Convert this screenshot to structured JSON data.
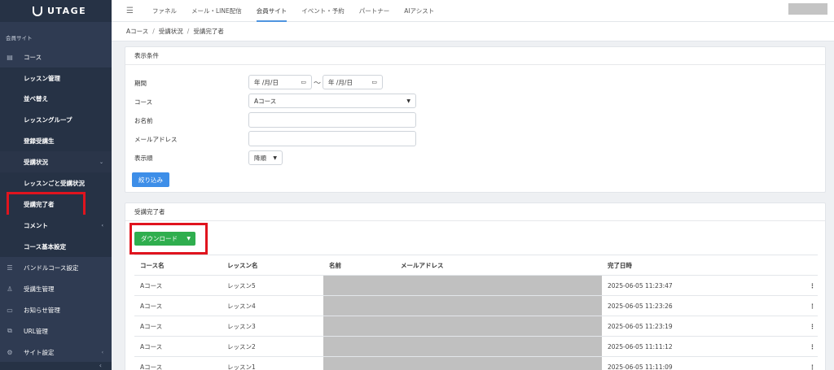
{
  "app": {
    "logo_text": "UTAGE"
  },
  "sidebar": {
    "section_label": "会員サイト",
    "items": [
      {
        "label": "コース",
        "icon": "book-icon"
      },
      {
        "label": "レッスン管理"
      },
      {
        "label": "並べ替え"
      },
      {
        "label": "レッスングループ"
      },
      {
        "label": "登録受講生"
      },
      {
        "label": "受講状況"
      },
      {
        "label": "レッスンごと受講状況"
      },
      {
        "label": "受講完了者"
      },
      {
        "label": "コメント"
      },
      {
        "label": "コース基本設定"
      },
      {
        "label": "バンドルコース設定",
        "icon": "list-icon"
      },
      {
        "label": "受講生管理",
        "icon": "user-icon"
      },
      {
        "label": "お知らせ管理",
        "icon": "news-icon"
      },
      {
        "label": "URL管理",
        "icon": "link-icon"
      },
      {
        "label": "サイト設定",
        "icon": "gear-icon"
      }
    ]
  },
  "topnav": {
    "items": [
      "ファネル",
      "メール・LINE配信",
      "会員サイト",
      "イベント・予約",
      "パートナー",
      "AIアシスト"
    ],
    "active": "会員サイト"
  },
  "breadcrumb": [
    "Aコース",
    "受講状況",
    "受講完了者"
  ],
  "filter": {
    "title": "表示条件",
    "period_label": "期間",
    "date_placeholder": "年 /月/日",
    "tilde": "～",
    "course_label": "コース",
    "course_value": "Aコース",
    "name_label": "お名前",
    "name_value": "",
    "email_label": "メールアドレス",
    "email_value": "",
    "order_label": "表示順",
    "order_value": "降順",
    "submit_label": "絞り込み"
  },
  "results": {
    "title": "受講完了者",
    "download_label": "ダウンロード",
    "columns": [
      "コース名",
      "レッスン名",
      "名前",
      "メールアドレス",
      "完了日時"
    ],
    "rows": [
      {
        "course": "Aコース",
        "lesson": "レッスン5",
        "completed": "2025-06-05 11:23:47"
      },
      {
        "course": "Aコース",
        "lesson": "レッスン4",
        "completed": "2025-06-05 11:23:26"
      },
      {
        "course": "Aコース",
        "lesson": "レッスン3",
        "completed": "2025-06-05 11:23:19"
      },
      {
        "course": "Aコース",
        "lesson": "レッスン2",
        "completed": "2025-06-05 11:11:12"
      },
      {
        "course": "Aコース",
        "lesson": "レッスン1",
        "completed": "2025-06-05 11:11:09"
      }
    ]
  },
  "colors": {
    "sidebar": "#2f3b52",
    "accent_blue": "#3d8ee8",
    "download_green": "#2fae4e",
    "highlight_red": "#e0141e"
  }
}
